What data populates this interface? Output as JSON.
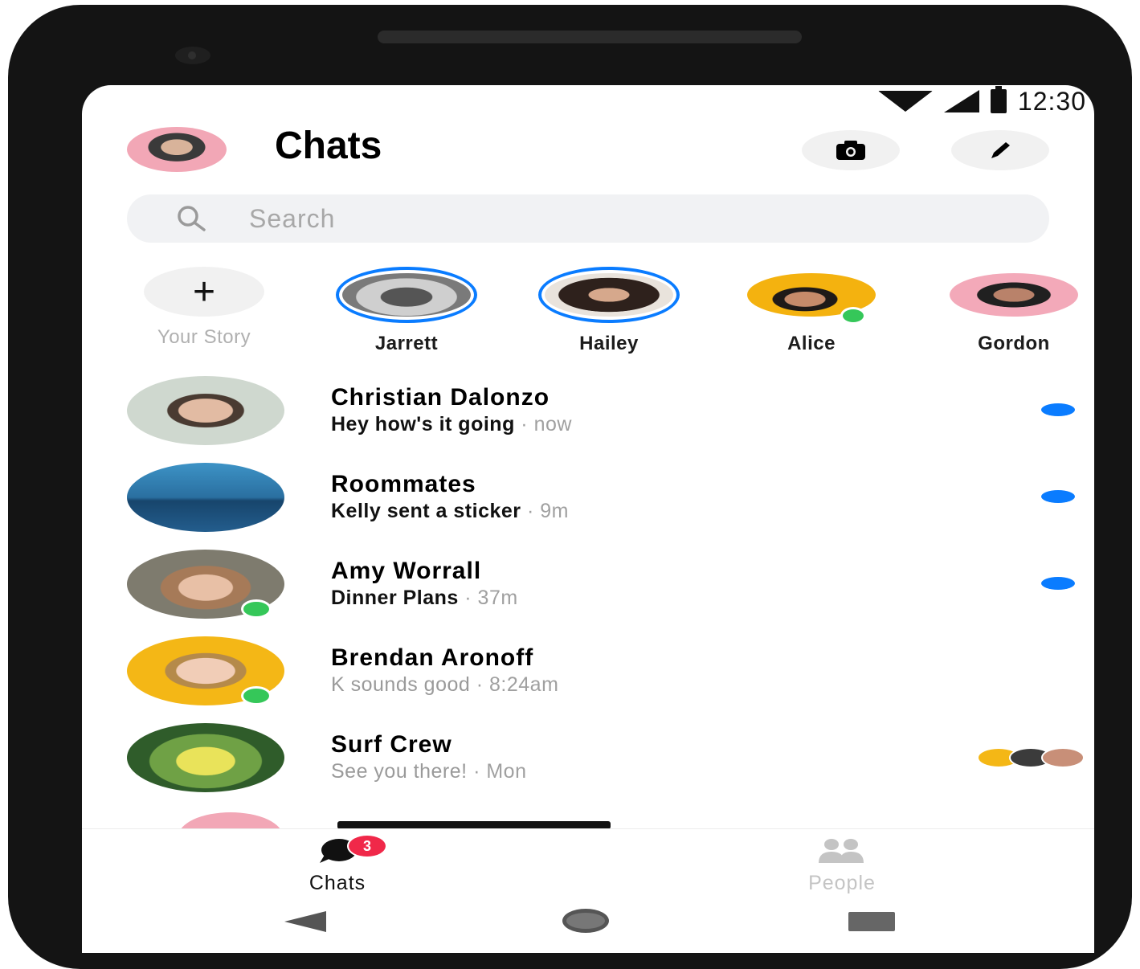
{
  "status_bar": {
    "time": "12:30"
  },
  "header": {
    "title": "Chats"
  },
  "search": {
    "placeholder": "Search"
  },
  "stories": [
    {
      "label": "Your Story"
    },
    {
      "label": "Jarrett"
    },
    {
      "label": "Hailey"
    },
    {
      "label": "Alice"
    },
    {
      "label": "Gordon"
    }
  ],
  "chats": [
    {
      "name": "Christian Dalonzo",
      "message": "Hey how's it going",
      "time": "· now"
    },
    {
      "name": "Roommates",
      "message": "Kelly sent a sticker",
      "time": "· 9m"
    },
    {
      "name": "Amy Worrall",
      "message": "Dinner Plans",
      "time": "· 37m"
    },
    {
      "name": "Brendan Aronoff",
      "message": "K sounds good",
      "time": "· 8:24am"
    },
    {
      "name": "Surf Crew",
      "message": "See you there!",
      "time": "· Mon"
    }
  ],
  "nav": {
    "chats_label": "Chats",
    "chats_badge": "3",
    "people_label": "People"
  },
  "colors": {
    "accent": "#0a7cff",
    "online": "#35c759",
    "badge": "#f02849"
  }
}
